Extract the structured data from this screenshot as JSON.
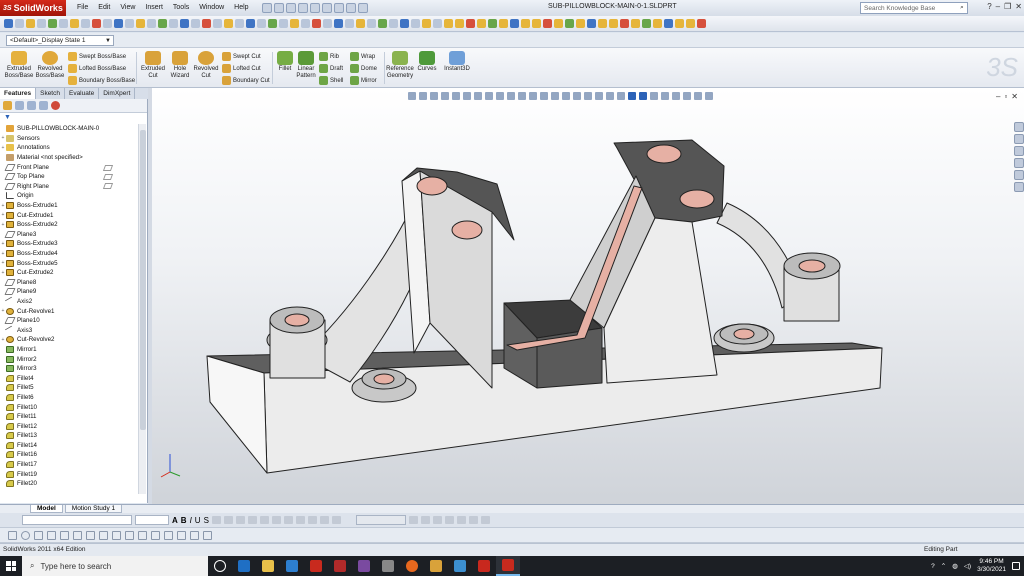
{
  "app": {
    "brand": "SolidWorks",
    "window_title": "SUB-PILLOWBLOCK-MAIN-0-1.SLDPRT",
    "menu": [
      "File",
      "Edit",
      "View",
      "Insert",
      "Tools",
      "Window",
      "Help"
    ],
    "search_placeholder": "Search Knowledge Base"
  },
  "config": {
    "selected": "<Default>_Display State 1"
  },
  "ribbon": {
    "extruded_boss": "Extruded Boss/Base",
    "revolved_boss": "Revolved Boss/Base",
    "swept_boss": "Swept Boss/Base",
    "lofted_boss": "Lofted Boss/Base",
    "boundary_boss": "Boundary Boss/Base",
    "extruded_cut": "Extruded Cut",
    "hole_wizard": "Hole Wizard",
    "revolved_cut": "Revolved Cut",
    "swept_cut": "Swept Cut",
    "lofted_cut": "Lofted Cut",
    "boundary_cut": "Boundary Cut",
    "fillet": "Fillet",
    "linear_pattern": "Linear Pattern",
    "rib": "Rib",
    "draft": "Draft",
    "shell": "Shell",
    "wrap": "Wrap",
    "dome": "Dome",
    "mirror": "Mirror",
    "reference_geometry": "Reference Geometry",
    "curves": "Curves",
    "instant3d": "Instant3D"
  },
  "cm_tabs": [
    "Features",
    "Sketch",
    "Evaluate",
    "DimXpert"
  ],
  "tree": [
    {
      "label": "SUB-PILLOWBLOCK-MAIN-0",
      "icon": "root",
      "exp": ""
    },
    {
      "label": "Sensors",
      "icon": "sensor",
      "exp": "+"
    },
    {
      "label": "Annotations",
      "icon": "anno",
      "exp": "+"
    },
    {
      "label": "Material <not specified>",
      "icon": "mat",
      "exp": ""
    },
    {
      "label": "Front Plane",
      "icon": "plane",
      "exp": ""
    },
    {
      "label": "Top Plane",
      "icon": "plane",
      "exp": ""
    },
    {
      "label": "Right Plane",
      "icon": "plane",
      "exp": ""
    },
    {
      "label": "Origin",
      "icon": "origin",
      "exp": ""
    },
    {
      "label": "Boss-Extrude1",
      "icon": "feat",
      "exp": "+"
    },
    {
      "label": "Cut-Extrude1",
      "icon": "feat",
      "exp": "+"
    },
    {
      "label": "Boss-Extrude2",
      "icon": "feat",
      "exp": "+"
    },
    {
      "label": "Plane3",
      "icon": "plane",
      "exp": ""
    },
    {
      "label": "Boss-Extrude3",
      "icon": "feat",
      "exp": "+"
    },
    {
      "label": "Boss-Extrude4",
      "icon": "feat",
      "exp": "+"
    },
    {
      "label": "Boss-Extrude5",
      "icon": "feat",
      "exp": "+"
    },
    {
      "label": "Cut-Extrude2",
      "icon": "feat",
      "exp": "+"
    },
    {
      "label": "Plane8",
      "icon": "plane",
      "exp": ""
    },
    {
      "label": "Plane9",
      "icon": "plane",
      "exp": ""
    },
    {
      "label": "Axis2",
      "icon": "axis",
      "exp": ""
    },
    {
      "label": "Cut-Revolve1",
      "icon": "revolve",
      "exp": "+"
    },
    {
      "label": "Plane10",
      "icon": "plane",
      "exp": ""
    },
    {
      "label": "Axis3",
      "icon": "axis",
      "exp": ""
    },
    {
      "label": "Cut-Revolve2",
      "icon": "revolve",
      "exp": "+"
    },
    {
      "label": "Mirror1",
      "icon": "mirror",
      "exp": ""
    },
    {
      "label": "Mirror2",
      "icon": "mirror",
      "exp": ""
    },
    {
      "label": "Mirror3",
      "icon": "mirror",
      "exp": ""
    },
    {
      "label": "Fillet4",
      "icon": "fillet",
      "exp": ""
    },
    {
      "label": "Fillet5",
      "icon": "fillet",
      "exp": ""
    },
    {
      "label": "Fillet6",
      "icon": "fillet",
      "exp": ""
    },
    {
      "label": "Fillet10",
      "icon": "fillet",
      "exp": ""
    },
    {
      "label": "Fillet11",
      "icon": "fillet",
      "exp": ""
    },
    {
      "label": "Fillet12",
      "icon": "fillet",
      "exp": ""
    },
    {
      "label": "Fillet13",
      "icon": "fillet",
      "exp": ""
    },
    {
      "label": "Fillet14",
      "icon": "fillet",
      "exp": ""
    },
    {
      "label": "Fillet16",
      "icon": "fillet",
      "exp": ""
    },
    {
      "label": "Fillet17",
      "icon": "fillet",
      "exp": ""
    },
    {
      "label": "Fillet19",
      "icon": "fillet",
      "exp": ""
    },
    {
      "label": "Fillet20",
      "icon": "fillet",
      "exp": ""
    }
  ],
  "bottom_tabs": [
    "Model",
    "Motion Study 1"
  ],
  "status": {
    "left": "SolidWorks 2011 x64 Edition",
    "right": "Editing Part"
  },
  "taskbar": {
    "search_placeholder": "Type here to search",
    "time": "9:46 PM",
    "date": "3/30/2021"
  },
  "colors": {
    "brand_red": "#c8200f",
    "bore_copper": "#e6b0a4",
    "part_gray": "#f2f2f2",
    "part_dark": "#4a4a4a"
  }
}
